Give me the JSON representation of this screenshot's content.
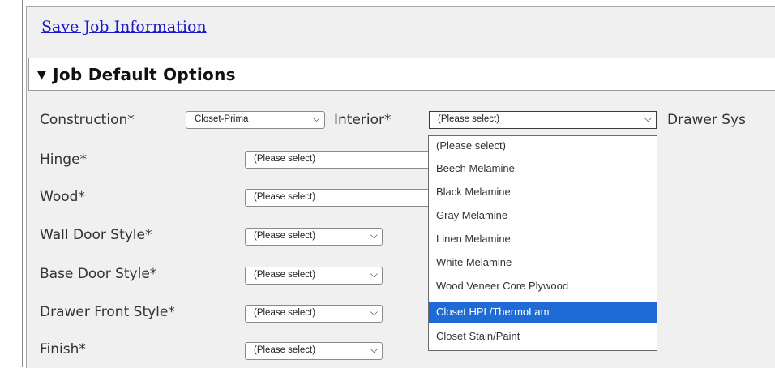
{
  "header": {
    "save_link": "Save Job Information"
  },
  "section": {
    "title": "Job Default Options",
    "toggle_icon": "triangle-down"
  },
  "fields": {
    "construction": {
      "label": "Construction*",
      "value": "Closet-Prima"
    },
    "interior": {
      "label": "Interior*",
      "value": "(Please select)"
    },
    "drawer_system": {
      "label": "Drawer Sys"
    },
    "hinge": {
      "label": "Hinge*",
      "value": "(Please select)"
    },
    "wood": {
      "label": "Wood*",
      "value": "(Please select)"
    },
    "wall_door_style": {
      "label": "Wall Door Style*",
      "value": "(Please select)"
    },
    "base_door_style": {
      "label": "Base Door Style*",
      "value": "(Please select)"
    },
    "drawer_front_style": {
      "label": "Drawer Front Style*",
      "value": "(Please select)"
    },
    "finish": {
      "label": "Finish*",
      "value": "(Please select)"
    }
  },
  "interior_dropdown": {
    "options": [
      "(Please select)",
      "Beech Melamine",
      "Black Melamine",
      "Gray Melamine",
      "Linen Melamine",
      "White Melamine",
      "Wood Veneer Core Plywood",
      "Closet HPL/ThermoLam",
      "Closet Stain/Paint"
    ],
    "highlighted": "Closet HPL/ThermoLam"
  },
  "colors": {
    "link": "#1a1ac8",
    "highlight": "#1e6bd6",
    "panel_bg": "#f0f0f0"
  }
}
